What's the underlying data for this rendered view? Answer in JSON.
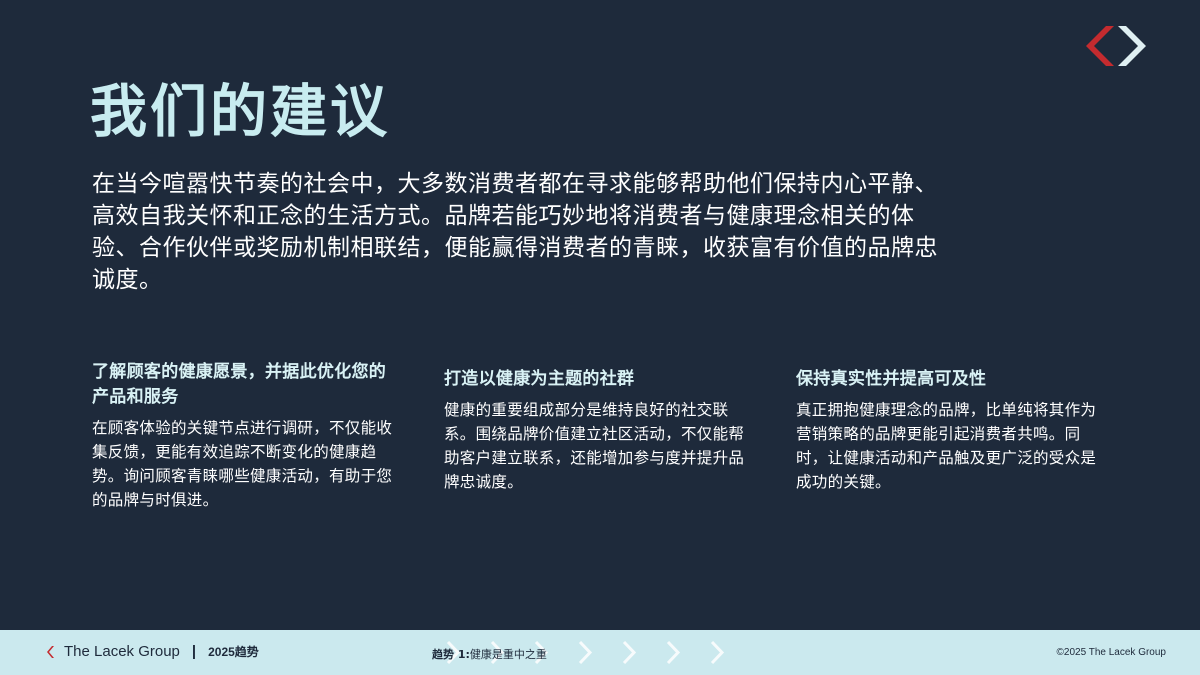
{
  "colors": {
    "background": "#1e2a3b",
    "title": "#c8ecf0",
    "text": "#ffffff",
    "footer_bg": "#cbe9ee",
    "brand_red": "#c42b2f",
    "brand_light": "#dfeff2"
  },
  "header": {
    "logo_icon": "lacek-chevron-logo-icon"
  },
  "title": "我们的建议",
  "intro": "在当今喧嚣快节奏的社会中，大多数消费者都在寻求能够帮助他们保持内心平静、高效自我关怀和正念的生活方式。品牌若能巧妙地将消费者与健康理念相关的体验、合作伙伴或奖励机制相联结，便能赢得消费者的青睐，收获富有价值的品牌忠诚度。",
  "recommendations": [
    {
      "heading": "了解顾客的健康愿景，并据此优化您的产品和服务",
      "body": "在顾客体验的关键节点进行调研，不仅能收集反馈，更能有效追踪不断变化的健康趋势。询问顾客青睐哪些健康活动，有助于您的品牌与时俱进。"
    },
    {
      "heading": "打造以健康为主题的社群",
      "body": "健康的重要组成部分是维持良好的社交联系。围绕品牌价值建立社区活动，不仅能帮助客户建立联系，还能增加参与度并提升品牌忠诚度。"
    },
    {
      "heading": "保持真实性并提高可及性",
      "body": "真正拥抱健康理念的品牌，比单纯将其作为营销策略的品牌更能引起消费者共鸣。同时，让健康活动和产品触及更广泛的受众是成功的关键。"
    }
  ],
  "footer": {
    "brand": "The Lacek Group",
    "separator": "|",
    "year_label": "2025趋势",
    "trend_label": "趋势 1:",
    "trend_title": "健康是重中之重",
    "copyright": "©2025 The Lacek Group"
  }
}
